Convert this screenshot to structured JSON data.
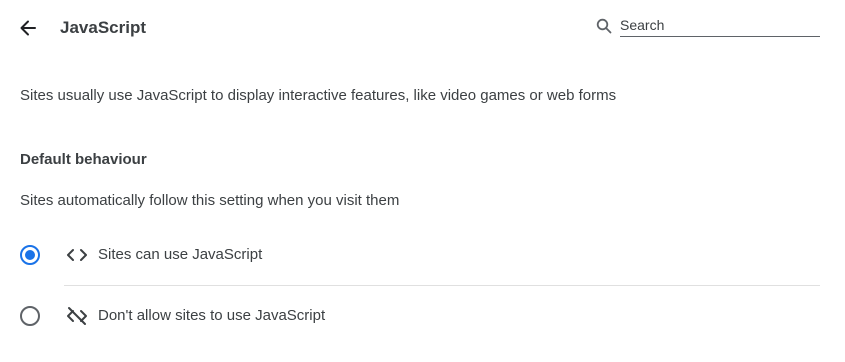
{
  "header": {
    "title": "JavaScript",
    "back_icon": "arrow-back-icon",
    "search": {
      "icon": "search-icon",
      "placeholder": "Search",
      "value": ""
    }
  },
  "description": "Sites usually use JavaScript to display interactive features, like video games or web forms",
  "default_behaviour": {
    "heading": "Default behaviour",
    "subtitle": "Sites automatically follow this setting when you visit them",
    "options": [
      {
        "label": "Sites can use JavaScript",
        "icon": "code-icon",
        "selected": true
      },
      {
        "label": "Don't allow sites to use JavaScript",
        "icon": "code-off-icon",
        "selected": false
      }
    ]
  },
  "colors": {
    "accent": "#1a73e8",
    "text": "#3c4043",
    "icon": "#5f6368",
    "divider": "#e0e0e0"
  }
}
